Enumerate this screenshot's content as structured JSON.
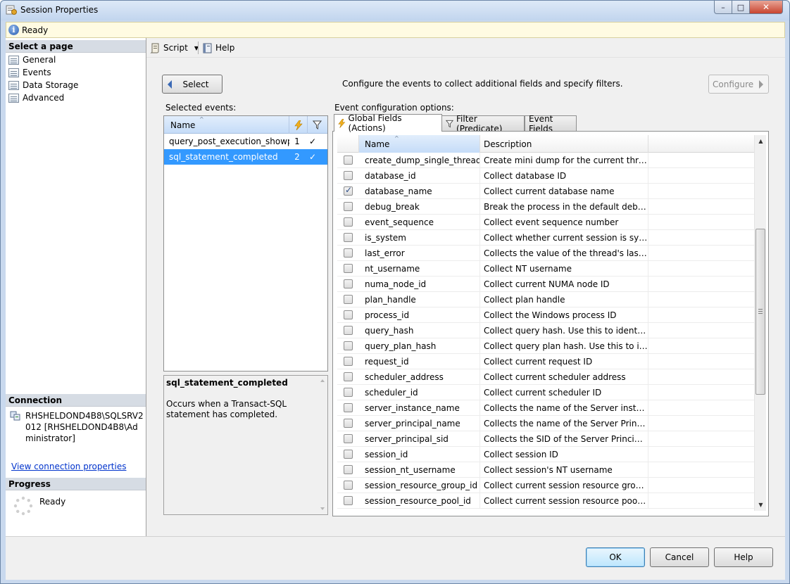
{
  "window": {
    "title": "Session Properties",
    "controls": {
      "minimize": "–",
      "maximize": "□",
      "close": "✕"
    }
  },
  "status": {
    "icon": "info-icon",
    "text": "Ready"
  },
  "left_pane": {
    "select_page_header": "Select a page",
    "pages": [
      {
        "label": "General",
        "icon": "page-icon"
      },
      {
        "label": "Events",
        "icon": "page-icon"
      },
      {
        "label": "Data Storage",
        "icon": "page-icon"
      },
      {
        "label": "Advanced",
        "icon": "page-icon"
      }
    ],
    "connection_header": "Connection",
    "connection_text": "RHSHELDOND4B8\\SQLSRV2012 [RHSHELDOND4B8\\Administrator]",
    "connection_link": "View connection properties",
    "progress_header": "Progress",
    "progress_text": "Ready"
  },
  "toolbar": {
    "script_label": "Script",
    "help_label": "Help"
  },
  "events_page": {
    "select_button": "Select",
    "instructions": "Configure the events to collect additional fields and specify filters.",
    "configure_button": "Configure",
    "selected_events_label": "Selected events:",
    "config_options_label": "Event configuration options:",
    "events_header": {
      "name": "Name"
    },
    "events": [
      {
        "name": "query_post_execution_showplan",
        "actions": "1",
        "filter": "✓",
        "selected": false
      },
      {
        "name": "sql_statement_completed",
        "actions": "2",
        "filter": "✓",
        "selected": true
      }
    ],
    "description": {
      "title": "sql_statement_completed",
      "text": "Occurs when a Transact-SQL statement has completed."
    },
    "tabs": [
      {
        "label": "Global Fields (Actions)",
        "active": true
      },
      {
        "label": "Filter (Predicate)",
        "active": false
      },
      {
        "label": "Event Fields",
        "active": false
      }
    ],
    "fields_header": {
      "name": "Name",
      "description": "Description"
    },
    "global_fields": [
      {
        "name": "create_dump_single_thread",
        "description": "Create mini dump for the current thread",
        "checked": false
      },
      {
        "name": "database_id",
        "description": "Collect database ID",
        "checked": false
      },
      {
        "name": "database_name",
        "description": "Collect current database name",
        "checked": true
      },
      {
        "name": "debug_break",
        "description": "Break the process in the default debugger",
        "checked": false
      },
      {
        "name": "event_sequence",
        "description": "Collect event sequence number",
        "checked": false
      },
      {
        "name": "is_system",
        "description": "Collect whether current session is system",
        "checked": false
      },
      {
        "name": "last_error",
        "description": "Collects the value of the thread's last Wind...",
        "checked": false
      },
      {
        "name": "nt_username",
        "description": "Collect NT username",
        "checked": false
      },
      {
        "name": "numa_node_id",
        "description": "Collect current NUMA node ID",
        "checked": false
      },
      {
        "name": "plan_handle",
        "description": "Collect plan handle",
        "checked": false
      },
      {
        "name": "process_id",
        "description": "Collect the Windows process ID",
        "checked": false
      },
      {
        "name": "query_hash",
        "description": "Collect query hash. Use this to identify que...",
        "checked": false
      },
      {
        "name": "query_plan_hash",
        "description": "Collect query plan hash. Use this to identif...",
        "checked": false
      },
      {
        "name": "request_id",
        "description": "Collect current request ID",
        "checked": false
      },
      {
        "name": "scheduler_address",
        "description": "Collect current scheduler address",
        "checked": false
      },
      {
        "name": "scheduler_id",
        "description": "Collect current scheduler ID",
        "checked": false
      },
      {
        "name": "server_instance_name",
        "description": "Collects the name of the Server instance",
        "checked": false
      },
      {
        "name": "server_principal_name",
        "description": "Collects the name of the Server Principal i...",
        "checked": false
      },
      {
        "name": "server_principal_sid",
        "description": "Collects the SID of the Server Principal in ...",
        "checked": false
      },
      {
        "name": "session_id",
        "description": "Collect session ID",
        "checked": false
      },
      {
        "name": "session_nt_username",
        "description": "Collect session's NT username",
        "checked": false
      },
      {
        "name": "session_resource_group_id",
        "description": "Collect current session resource group ID",
        "checked": false
      },
      {
        "name": "session_resource_pool_id",
        "description": "Collect current session resource pool ID",
        "checked": false
      }
    ]
  },
  "buttons": {
    "ok": "OK",
    "cancel": "Cancel",
    "help": "Help"
  }
}
